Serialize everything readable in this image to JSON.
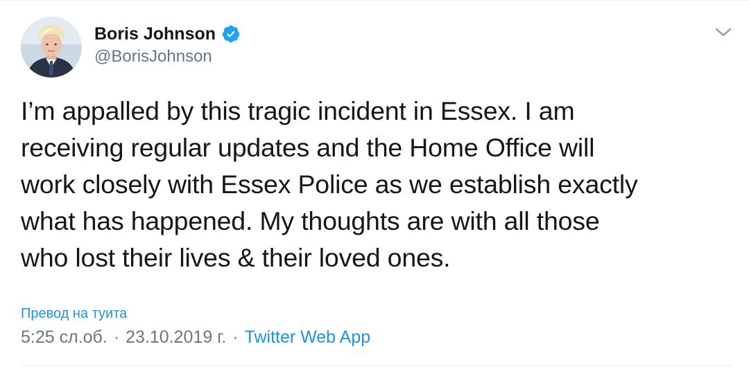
{
  "author": {
    "display_name": "Boris Johnson",
    "handle": "@BorisJohnson",
    "verified": true,
    "avatar_icon": "profile-photo"
  },
  "menu": {
    "icon": "chevron-down-icon"
  },
  "tweet": {
    "text": "I’m appalled by this tragic incident in Essex. I am\nreceiving regular updates and the Home Office will\nwork closely with Essex Police as we establish exactly\nwhat has happened. My thoughts are with all those\nwho lost their lives & their loved ones.",
    "translate_label": "Превод на туита",
    "time": "5:25 сл.об.",
    "date": "23.10.2019 г.",
    "separator": "·",
    "source": "Twitter Web App"
  },
  "colors": {
    "text": "#14171a",
    "secondary": "#657786",
    "link": "#1b95e0",
    "verified": "#1da1f2",
    "divider": "#e6ecf0"
  }
}
